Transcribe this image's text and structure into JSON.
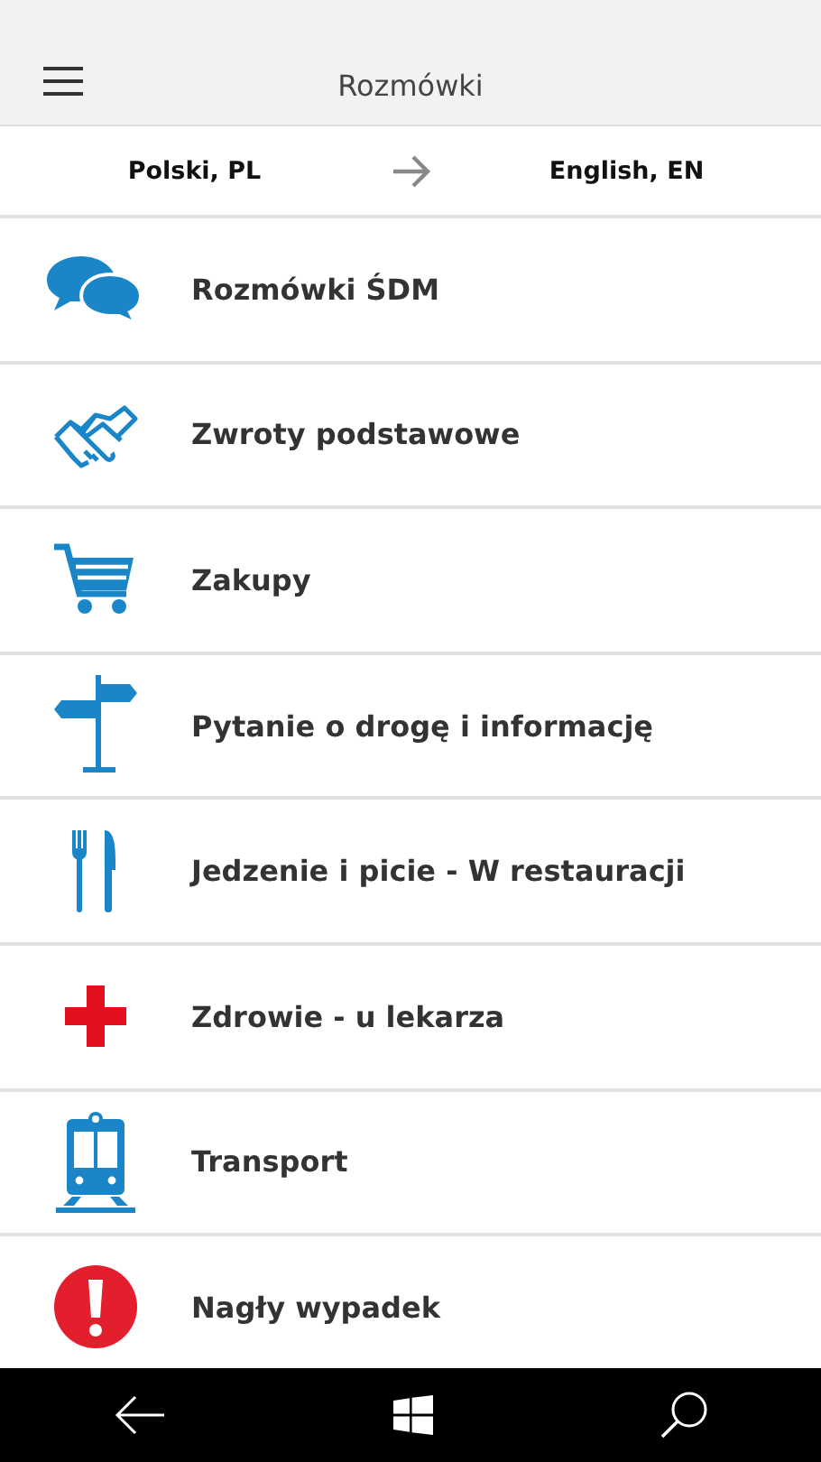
{
  "header": {
    "title": "Rozmówki"
  },
  "languages": {
    "source": "Polski, PL",
    "target": "English, EN"
  },
  "categories": [
    {
      "kind": "chat",
      "label": "Rozmówki ŚDM"
    },
    {
      "kind": "handshake",
      "label": "Zwroty podstawowe"
    },
    {
      "kind": "cart",
      "label": "Zakupy"
    },
    {
      "kind": "signpost",
      "label": "Pytanie o drogę i informację"
    },
    {
      "kind": "cutlery",
      "label": "Jedzenie i picie - W restauracji"
    },
    {
      "kind": "cross",
      "label": "Zdrowie - u lekarza"
    },
    {
      "kind": "train",
      "label": "Transport"
    },
    {
      "kind": "alert",
      "label": "Nagły wypadek"
    }
  ]
}
